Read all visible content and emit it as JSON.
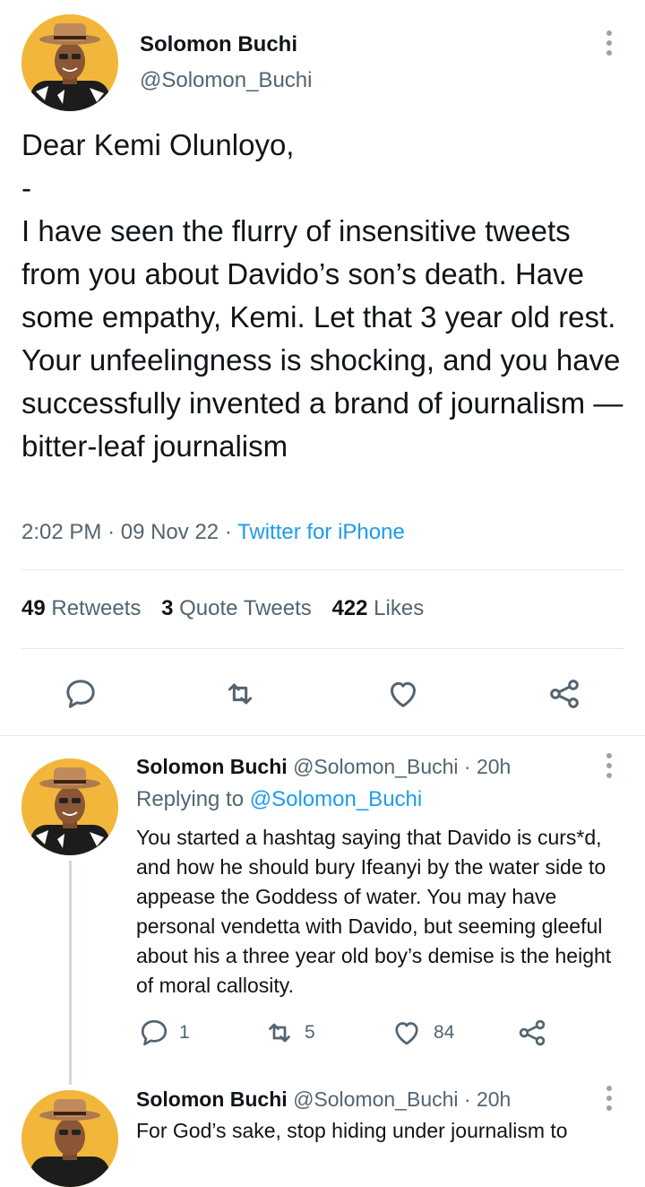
{
  "main_tweet": {
    "author_name": "Solomon Buchi",
    "author_handle": "@Solomon_Buchi",
    "text": "Dear Kemi Olunloyo,\n-\nI have seen the flurry of insensitive tweets from you about Davido’s son’s death. Have some empathy, Kemi. Let that 3 year old rest. Your unfeelingness is shocking, and you have successfully invented a brand of journalism — bitter-leaf journalism",
    "time": "2:02 PM",
    "date": "09 Nov 22",
    "source": "Twitter for iPhone",
    "separator": "·",
    "stats": {
      "retweets_count": "49",
      "retweets_label": "Retweets",
      "quotes_count": "3",
      "quotes_label": "Quote Tweets",
      "likes_count": "422",
      "likes_label": "Likes"
    }
  },
  "replies": [
    {
      "author_name": "Solomon Buchi",
      "author_handle": "@Solomon_Buchi",
      "separator": "·",
      "age": "20h",
      "replying_label": "Replying to",
      "replying_handle": "@Solomon_Buchi",
      "text": "You started a hashtag saying that Davido is curs*d, and how he should bury Ifeanyi by the water side to appease the Goddess of water. You may have personal vendetta with Davido, but seeming gleeful about his a three year old boy’s demise is the height of moral callosity.",
      "reply_count": "1",
      "retweet_count": "5",
      "like_count": "84"
    },
    {
      "author_name": "Solomon Buchi",
      "author_handle": "@Solomon_Buchi",
      "separator": "·",
      "age": "20h",
      "text": "For God’s sake, stop hiding under journalism to"
    }
  ],
  "colors": {
    "accent": "#1d9bf0",
    "muted": "#536471",
    "divider": "#e1e8ed",
    "avatar_bg": "#f2b73a"
  }
}
